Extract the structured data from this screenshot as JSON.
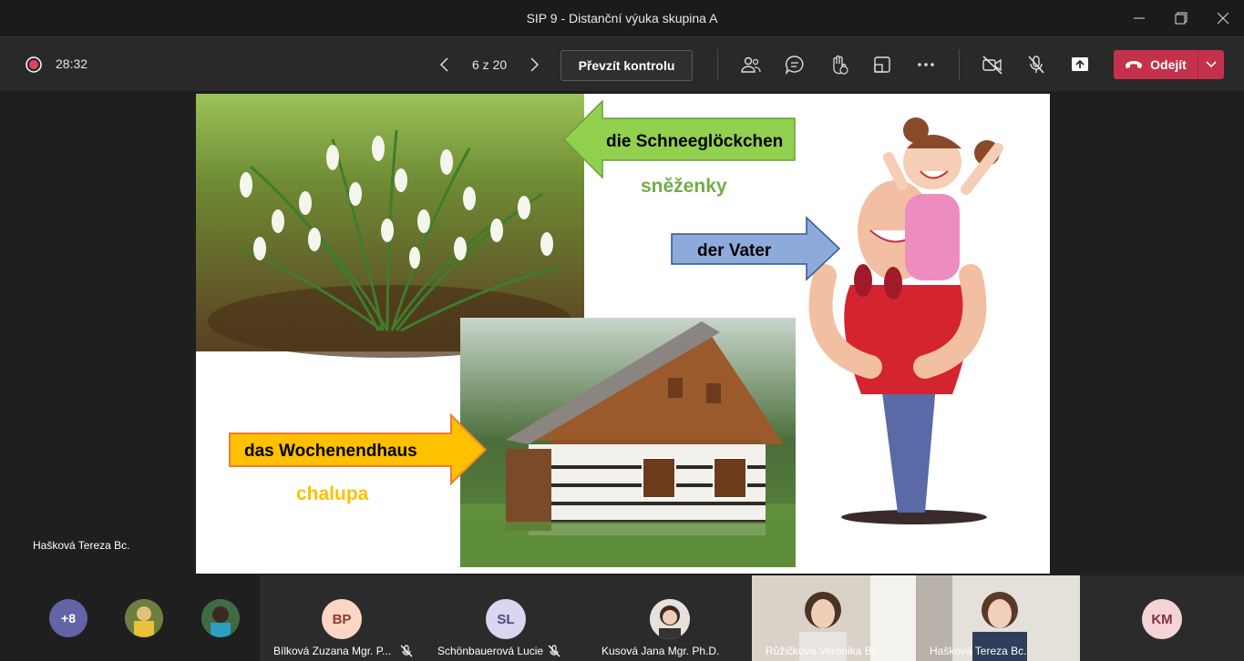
{
  "window": {
    "title": "SIP 9 - Distanční výuka skupina A"
  },
  "toolbar": {
    "timer": "28:32",
    "page_indicator": "6 z 20",
    "take_control": "Převzít kontrolu",
    "leave": "Odejít"
  },
  "stage": {
    "presenter_name": "Hašková Tereza Bc."
  },
  "slide": {
    "snowdrop_de": "die Schneeglöckchen",
    "snowdrop_cz": "sněženky",
    "father_de": "der Vater",
    "house_de": "das Wochenendhaus",
    "house_cz": "chalupa",
    "colors": {
      "green": "#92d050",
      "green_text": "#70ad47",
      "blue": "#8eaadb",
      "orange": "#ffc000",
      "orange_text": "#ffc000"
    }
  },
  "participants": {
    "overflow": "+8",
    "tiles": [
      {
        "initials": "BP",
        "name": "Bílková Zuzana Mgr. P..."
      },
      {
        "initials": "SL",
        "name": "Schönbauerová Lucie"
      },
      {
        "initials": "",
        "name": "Kusová Jana Mgr. Ph.D."
      },
      {
        "initials": "",
        "name": "Růžičková Veronika Bc."
      },
      {
        "initials": "",
        "name": "Hašková Tereza Bc."
      },
      {
        "initials": "KM",
        "name": ""
      }
    ]
  },
  "accent": "#c4314b"
}
